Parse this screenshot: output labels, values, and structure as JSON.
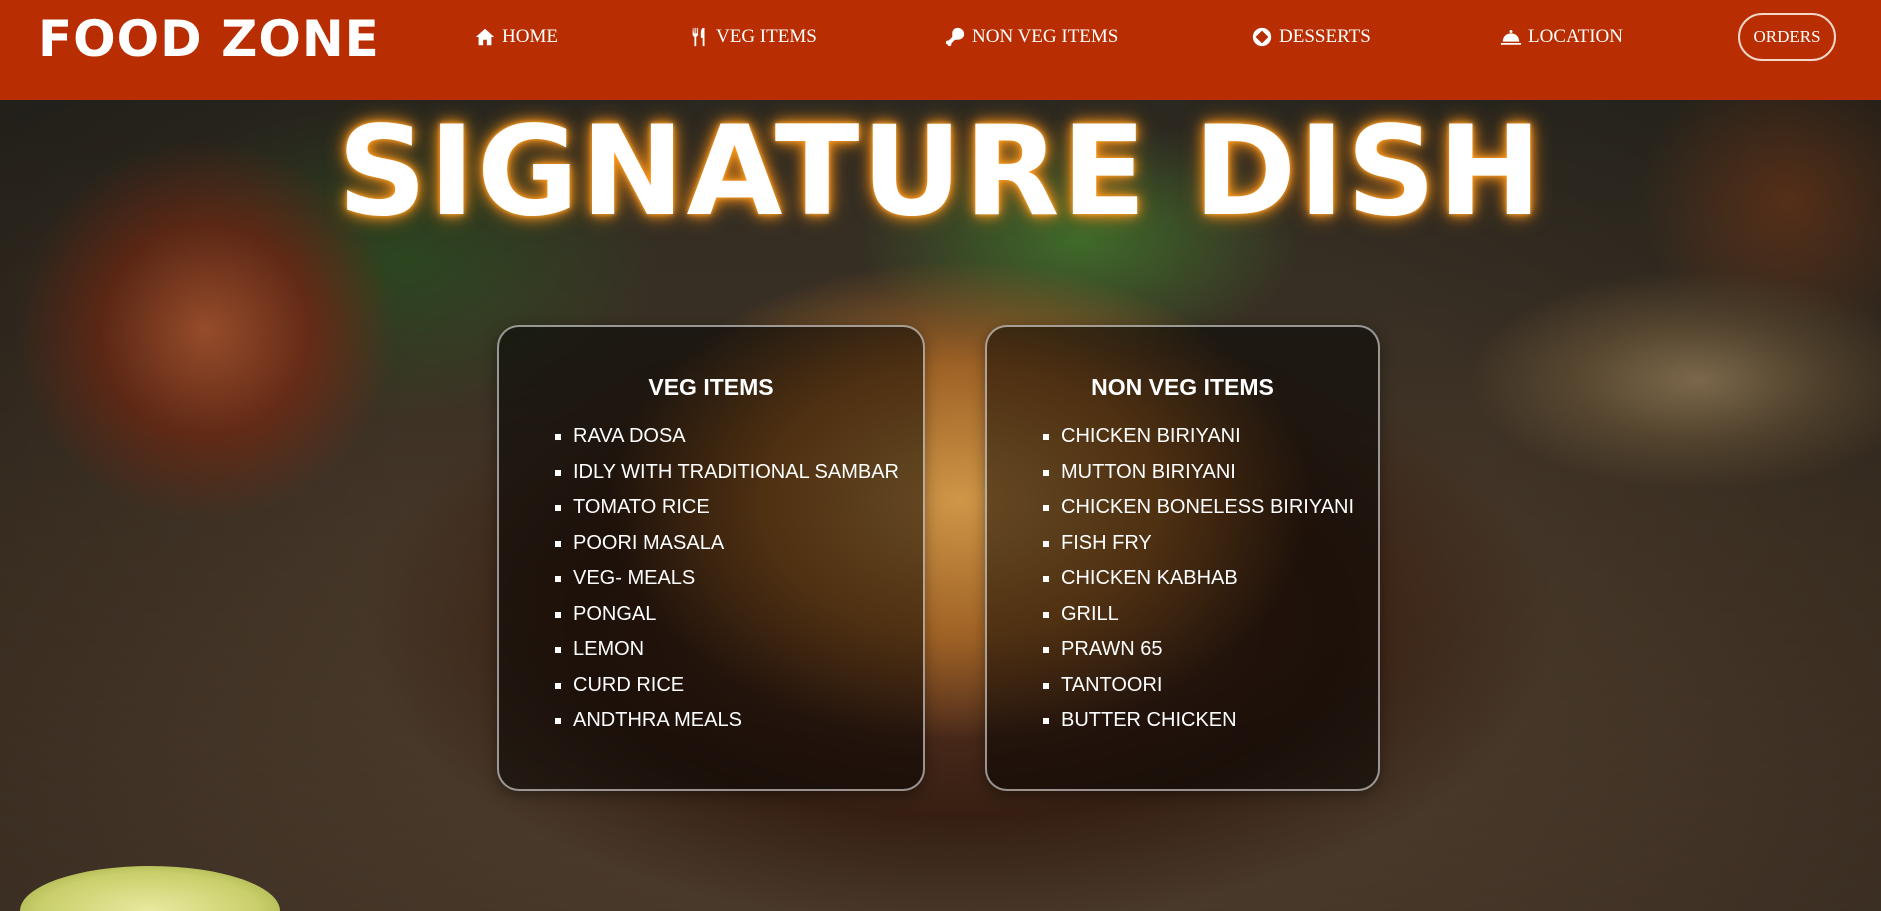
{
  "brand": "FOOD ZONE",
  "nav": [
    {
      "label": "HOME",
      "icon": "home-icon"
    },
    {
      "label": "VEG ITEMS",
      "icon": "utensils-icon"
    },
    {
      "label": "NON VEG ITEMS",
      "icon": "drumstick-icon"
    },
    {
      "label": "DESSERTS",
      "icon": "cookie-icon"
    },
    {
      "label": "LOCATION",
      "icon": "cloche-icon"
    }
  ],
  "orders_label": "ORDERS",
  "headline": "SIGNATURE DISH",
  "menus": {
    "veg": {
      "title": "VEG ITEMS",
      "items": [
        "RAVA DOSA",
        "IDLY WITH TRADITIONAL SAMBAR",
        "TOMATO RICE",
        "POORI MASALA",
        "VEG- MEALS",
        "PONGAL",
        "LEMON",
        "CURD RICE",
        "ANDTHRA MEALS"
      ]
    },
    "nonveg": {
      "title": "NON VEG ITEMS",
      "items": [
        "CHICKEN BIRIYANI",
        "MUTTON BIRIYANI",
        "CHICKEN BONELESS BIRIYANI",
        "FISH FRY",
        "CHICKEN KABHAB",
        "GRILL",
        "PRAWN 65",
        "TANTOORI",
        "BUTTER CHICKEN"
      ]
    }
  },
  "colors": {
    "header_bg": "#b82e02",
    "headline_glow": "#ff9a1a",
    "card_bg": "rgba(0,0,0,0.5)"
  }
}
